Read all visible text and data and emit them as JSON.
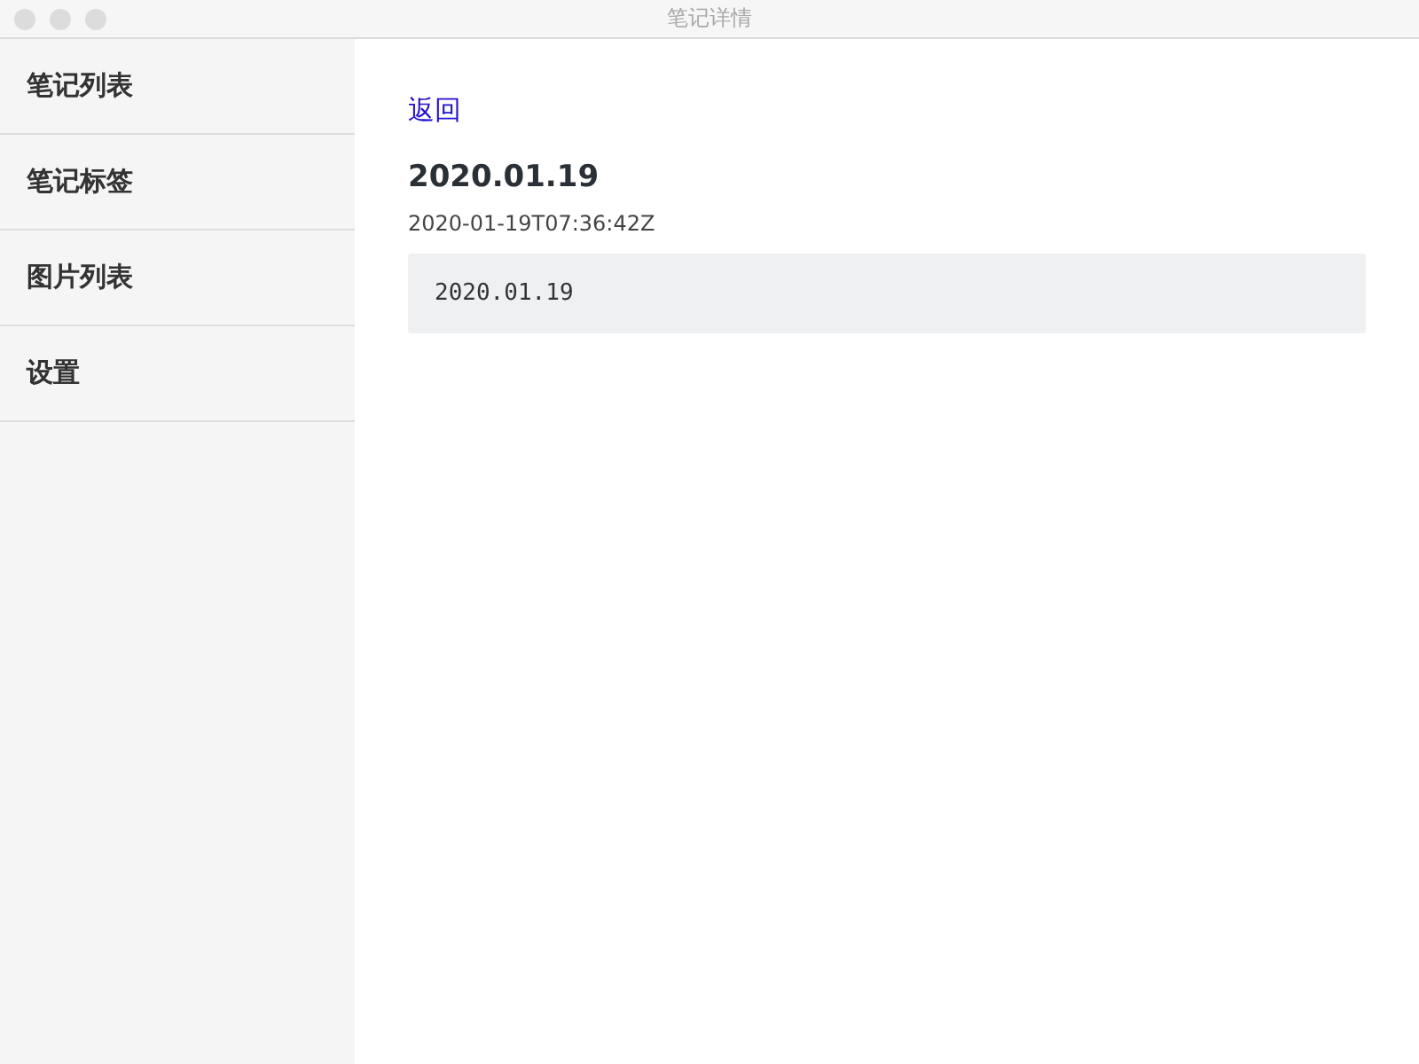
{
  "window": {
    "title": "笔记详情"
  },
  "sidebar": {
    "items": [
      {
        "label": "笔记列表"
      },
      {
        "label": "笔记标签"
      },
      {
        "label": "图片列表"
      },
      {
        "label": "设置"
      }
    ]
  },
  "note": {
    "back_link": "返回",
    "title": "2020.01.19",
    "timestamp": "2020-01-19T07:36:42Z",
    "body": "2020.01.19"
  }
}
